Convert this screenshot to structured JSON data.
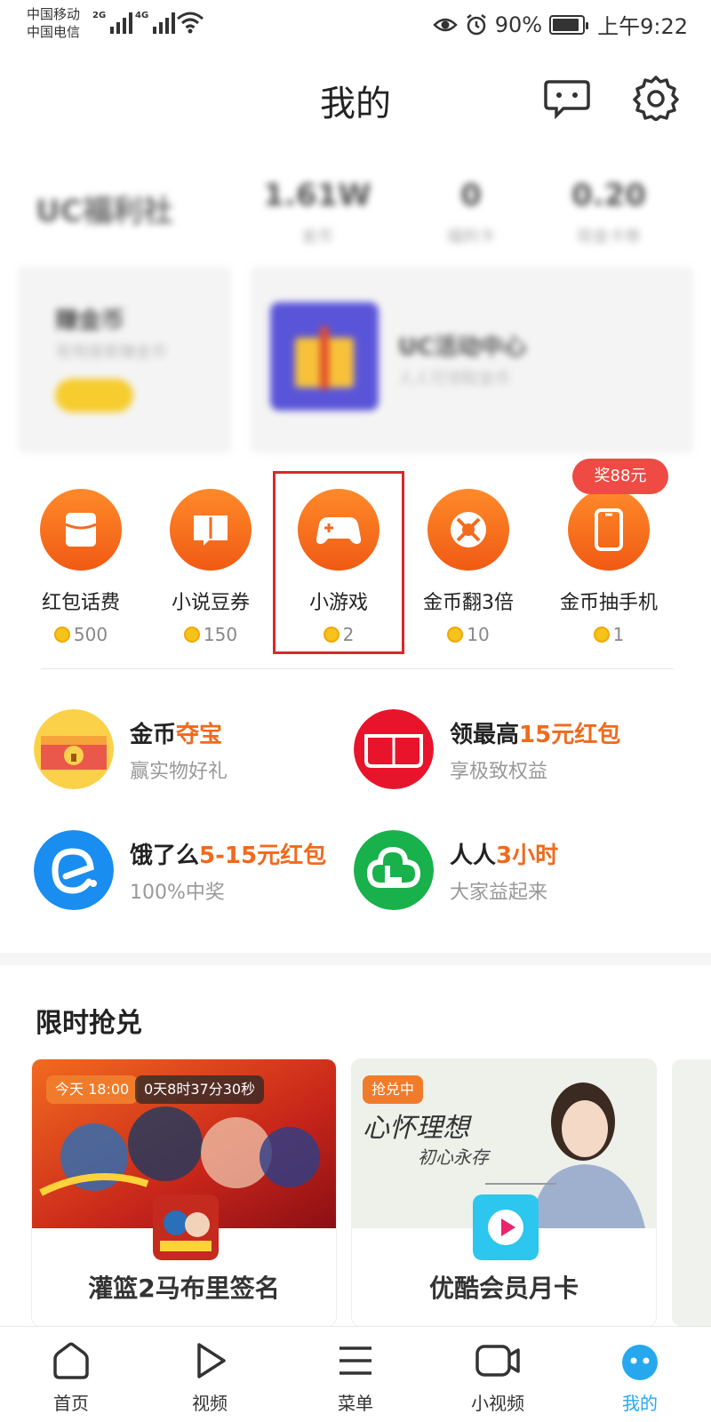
{
  "status_bar": {
    "carrier1": "中国移动",
    "carrier2": "中国电信",
    "net1": "2G",
    "net2": "4G",
    "battery": "90%",
    "time": "上午9:22"
  },
  "header": {
    "title": "我的"
  },
  "welfare": {
    "title": "UC福利社",
    "stats": [
      {
        "value": "1.61W",
        "label": "金币"
      },
      {
        "value": "0",
        "label": "福利卡"
      },
      {
        "value": "0.20",
        "label": "现金卡券"
      }
    ],
    "earn": {
      "title": "赚金币",
      "subtitle": "常用搜索赚金币"
    },
    "activity": {
      "title": "UC活动中心",
      "subtitle": "人人可领取金币"
    }
  },
  "tasks": [
    {
      "label": "红包话费",
      "coins": "500",
      "icon": "phone-card-icon"
    },
    {
      "label": "小说豆券",
      "coins": "150",
      "icon": "book-icon"
    },
    {
      "label": "小游戏",
      "coins": "2",
      "icon": "gamepad-icon"
    },
    {
      "label": "金币翻3倍",
      "coins": "10",
      "icon": "wheel-icon"
    },
    {
      "label": "金币抽手机",
      "coins": "1",
      "icon": "phone-icon"
    }
  ],
  "task_badge": "奖88元",
  "promos": [
    {
      "title_a": "金币",
      "title_b": "夺宝",
      "title_c": "",
      "subtitle": "赢实物好礼"
    },
    {
      "title_a": "领最高",
      "title_b": "15元红包",
      "title_c": "",
      "subtitle": "享极致权益"
    },
    {
      "title_a": "饿了么",
      "title_b": "5-15元红包",
      "title_c": "",
      "subtitle": "100%中奖"
    },
    {
      "title_a": "人人",
      "title_b": "3小时",
      "title_c": "",
      "subtitle": "大家益起来"
    }
  ],
  "flash_sale": {
    "title": "限时抢兑",
    "items": [
      {
        "tag": "今天 18:00",
        "countdown": "0天8时37分30秒",
        "name": "灌篮2马布里签名"
      },
      {
        "tag": "抢兑中",
        "banner_text_1": "心怀理想",
        "banner_text_2": "初心永存",
        "name": "优酷会员月卡"
      }
    ]
  },
  "bottom_nav": [
    {
      "label": "首页"
    },
    {
      "label": "视频"
    },
    {
      "label": "菜单"
    },
    {
      "label": "小视频"
    },
    {
      "label": "我的"
    }
  ],
  "colors": {
    "accent_orange": "#f06a1e",
    "highlight_red": "#d8282d",
    "active_blue": "#27a8ee"
  }
}
